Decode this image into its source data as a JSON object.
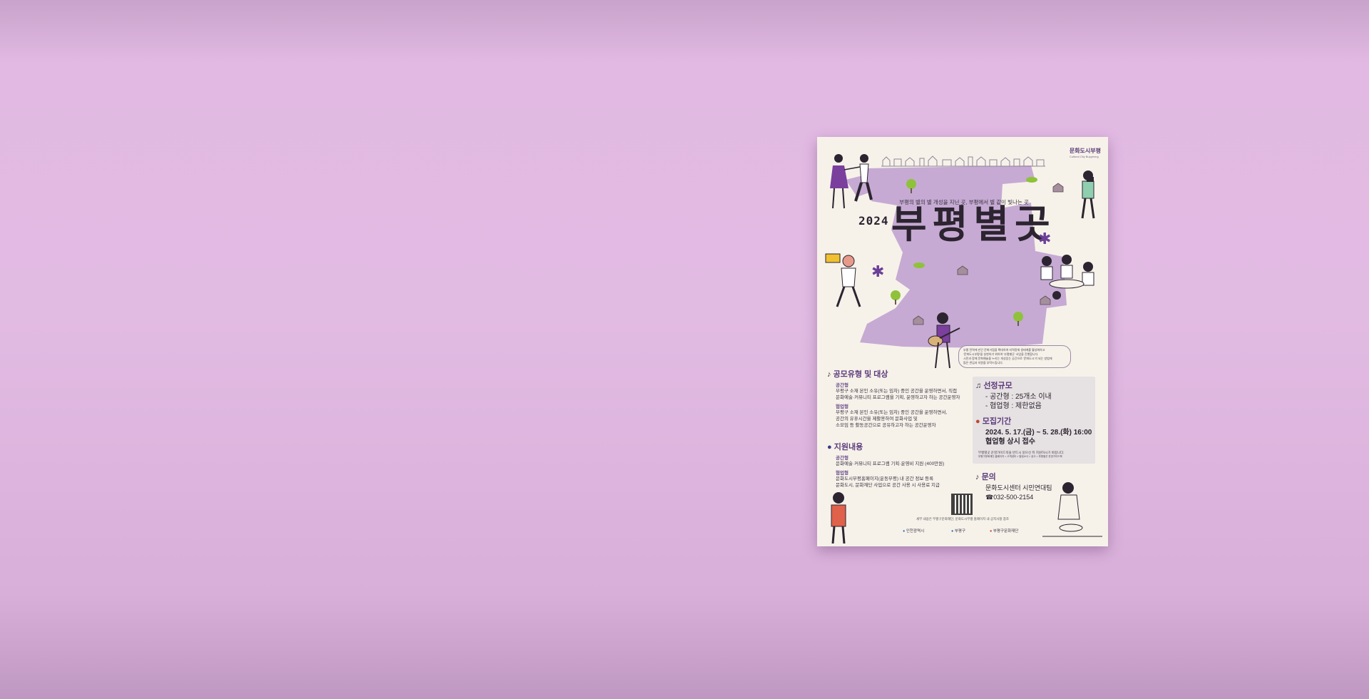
{
  "poster": {
    "tagline": "부평의 별의 별 개성을 지닌 곳, 부평에서 별 같이 빛나는 곳",
    "year": "2024",
    "title": "부평별곳",
    "brand": "문화도시부평",
    "brand_sub": "Cultural City Bupyeong",
    "intro_lines": [
      "부평 전역에 만간 문화거점을 확대하여 지역정체 생태계를 활성화하고",
      "'문화도시부평'을 실현하기 위하여 '부평별곳' 사업을 진행합니다.",
      "시민과 함께 문화예술을 누리는 개성있는 공간으로 '문화도시'가 되는 방법에",
      "많은 관심과 지원을 부탁드립니다."
    ],
    "recruit_type": {
      "title": "공모유형 및 대상",
      "space_type_badge": "공간형",
      "space_type_lines": [
        "부평구 소재 본인 소유(또는 임차) 중인 공간을 운영하면서, 직접",
        "문화예술·커뮤니티 프로그램을 기획, 운영하고자 하는 공간운영자"
      ],
      "coop_type_badge": "협업형",
      "coop_type_lines": [
        "부평구 소재 본인 소유(또는 임차) 중인 공간을 운영하면서,",
        "공간의 유휴시간을 제활용하여 문화사업 및",
        "소모임 등 활동공간으로 공유하고자 하는 공간운영자"
      ]
    },
    "support": {
      "title": "지원내용",
      "space_type_badge": "공간형",
      "space_type_lines": [
        "문화예술·커뮤니티 프로그램 기획·운영비 지원 (400만원)"
      ],
      "coop_type_badge": "협업형",
      "coop_type_lines": [
        "문화도시부평홈페이지(운동부평) 내 공간 정보 등록",
        "문화도시, 문화재단 사업으로 공간 사용 시 사용료 지급"
      ]
    },
    "selection": {
      "title": "선정규모",
      "lines": [
        "- 공간형 : 25개소 이내",
        "- 협업형 : 제한없음"
      ]
    },
    "period": {
      "title": "모집기간",
      "date_line": "2024. 5. 17.(금) ~ 5. 28.(화) 16:00",
      "coop_line": "협업형 상시 접수",
      "note_line1": "부평별곳 운영가이드북을 반드시 읽으신 뒤 지원하시기 바랍니다.",
      "note_line2": "부평구문화재단 홈페이지 > 고객센터 > 알림소식 > 공고 > 부평별곳 운영가이드북"
    },
    "contact": {
      "title": "문의",
      "org": "문화도시센터 시민연대팀",
      "phone": "☎032-500-2154"
    },
    "footer_note": "세부 내용은 부평구문화재단, 문화도시부평 홈페이지 내 공지사항 참조",
    "logos": [
      "인천광역시",
      "부평구",
      "부평구문화재단"
    ]
  },
  "colors": {
    "background": "#e2bbe3",
    "poster_paper": "#f6f2ea",
    "blob_lavender": "#c6aad3",
    "accent_purple": "#5c3a7c"
  }
}
